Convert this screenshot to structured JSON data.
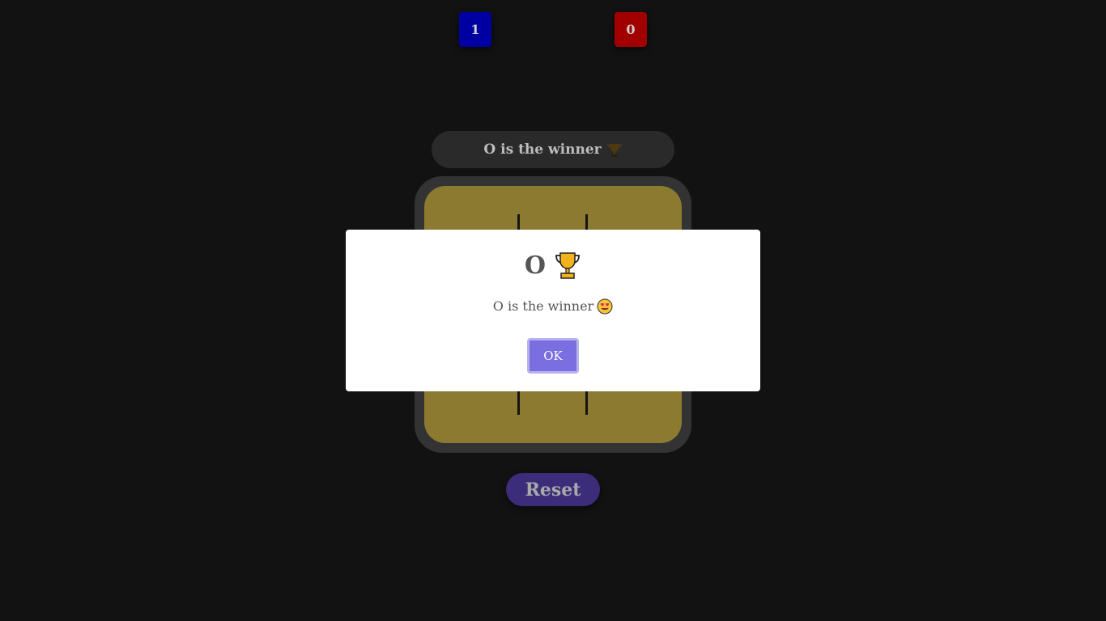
{
  "scores": {
    "x_score": "1",
    "o_score": "0",
    "x_color": "#0000a2",
    "o_color": "#a20000"
  },
  "status": {
    "text": "O is the winner",
    "icon": "trophy-icon"
  },
  "board": {
    "background": "#8c7a30"
  },
  "reset": {
    "label": "Reset"
  },
  "modal": {
    "title": "O",
    "title_icon": "trophy-icon",
    "message": "O is the winner",
    "message_icon": "heart-eyes-emoji-icon",
    "ok_label": "OK"
  }
}
